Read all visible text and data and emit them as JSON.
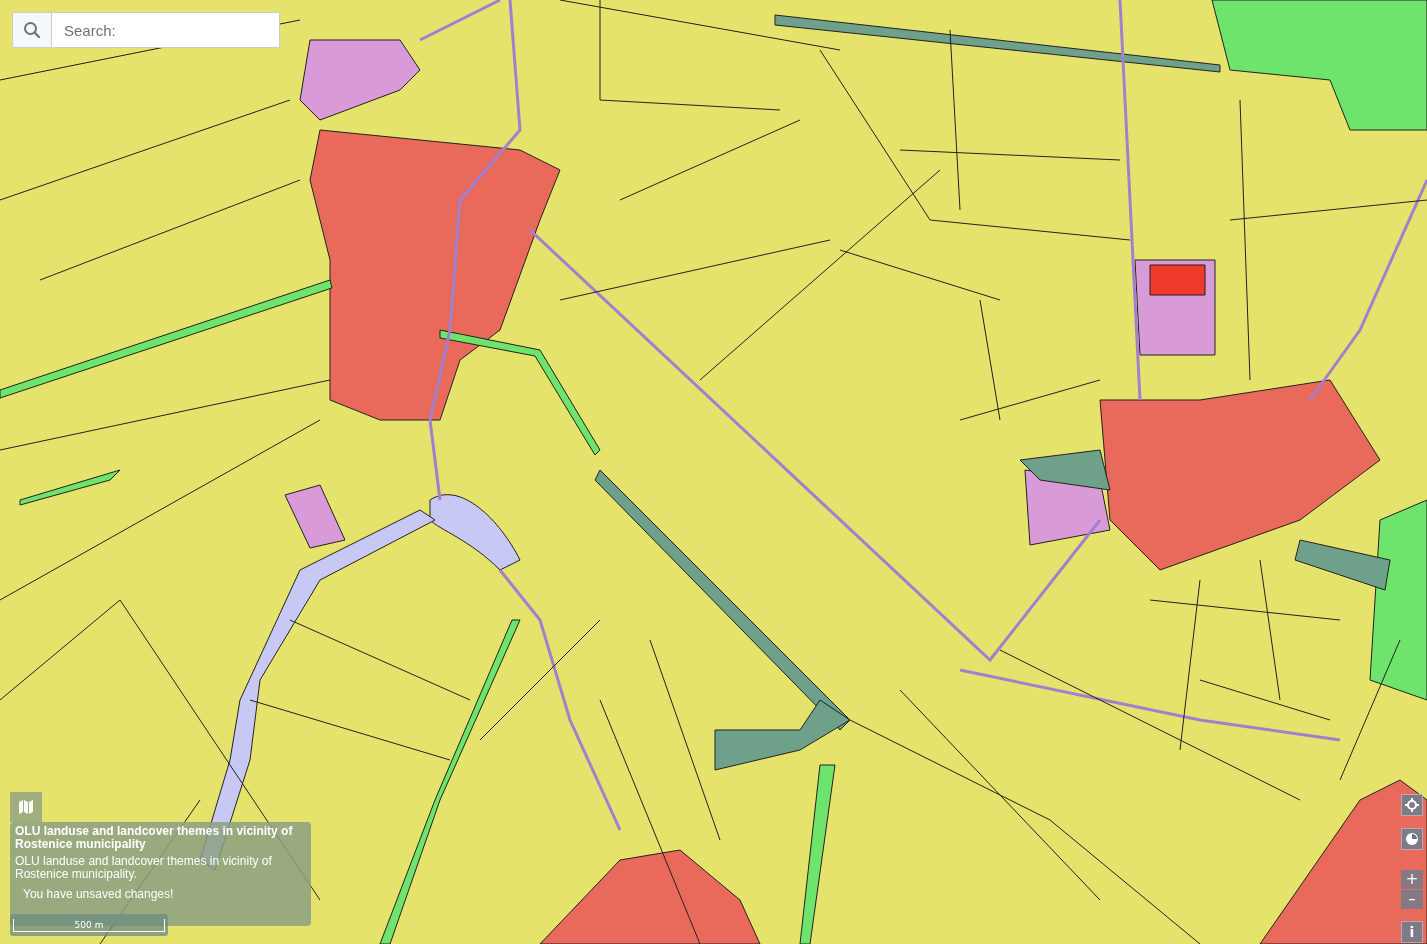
{
  "search": {
    "placeholder": "Search:"
  },
  "info_panel": {
    "title": "OLU landuse and landcover themes in vicinity of Rostenice municipality",
    "description": "OLU landuse and landcover themes in vicinity of Rostenice municipality.",
    "notice": "You have unsaved changes!"
  },
  "scale_bar": {
    "label": "500 m"
  },
  "zoom_controls": {
    "zoom_in": "+",
    "zoom_out": "–"
  },
  "info_button": {
    "label": "i"
  }
}
